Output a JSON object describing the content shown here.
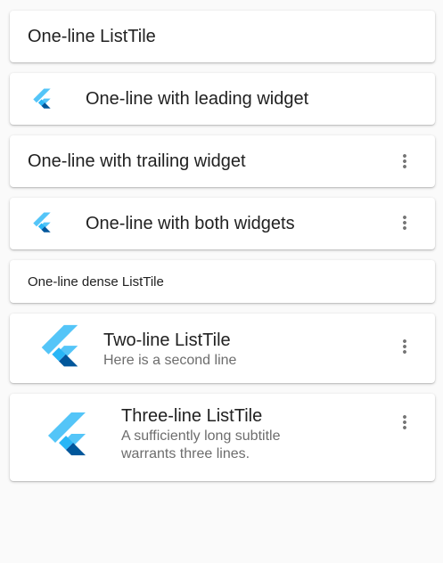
{
  "tiles": {
    "one_line": {
      "title": "One-line ListTile"
    },
    "leading": {
      "title": "One-line with leading widget",
      "leading_icon": "flutter-logo-icon"
    },
    "trailing": {
      "title": "One-line with trailing widget",
      "trailing_icon": "more-vert-icon"
    },
    "both": {
      "title": "One-line with both widgets",
      "leading_icon": "flutter-logo-icon",
      "trailing_icon": "more-vert-icon"
    },
    "dense": {
      "title": "One-line dense ListTile"
    },
    "two_line": {
      "title": "Two-line ListTile",
      "subtitle": "Here is a second line",
      "leading_icon": "flutter-logo-icon",
      "trailing_icon": "more-vert-icon"
    },
    "three_line": {
      "title": "Three-line ListTile",
      "subtitle_line1": "A sufficiently long subtitle",
      "subtitle_line2": "warrants three lines.",
      "leading_icon": "flutter-logo-icon",
      "trailing_icon": "more-vert-icon"
    }
  },
  "colors": {
    "logo_light": "#54C5F8",
    "logo_mid": "#29B6F6",
    "logo_dark": "#01579B",
    "icon_grey": "#757575"
  }
}
